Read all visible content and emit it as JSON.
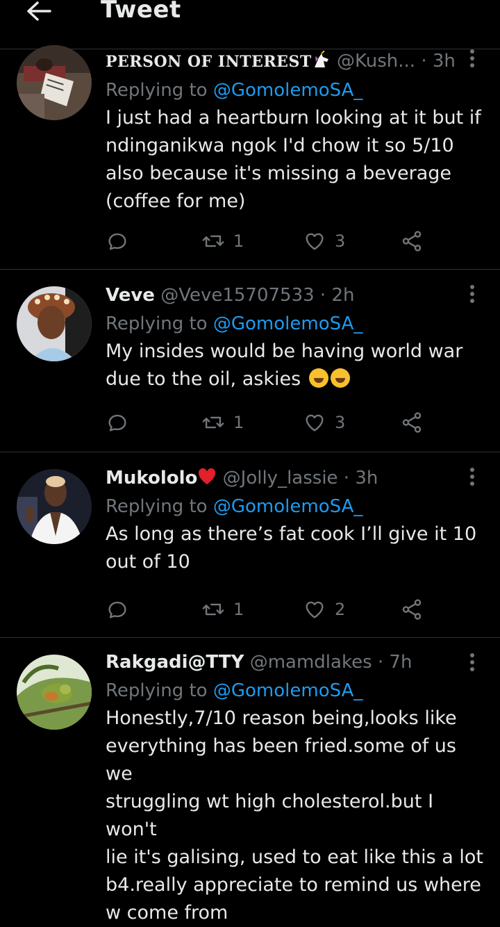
{
  "header": {
    "title": "Tweet",
    "back_icon": "arrow-left-icon"
  },
  "tweets": [
    {
      "name": "PERSON OF INTEREST",
      "name_emoji": "unicorn-icon",
      "handle": "@Kush...",
      "time": "3h",
      "replying_prefix": "Replying to",
      "replying_to": "@GomolemoSA_",
      "lines": [
        "I just had a heartburn looking at it but if",
        "ndinganikwa ngok I'd chow it so 5/10",
        "also because it's missing a beverage",
        "(coffee for me)"
      ],
      "retweets": "1",
      "likes": "3"
    },
    {
      "name": "Veve",
      "handle": "@Veve15707533",
      "time": "2h",
      "replying_prefix": "Replying to",
      "replying_to": "@GomolemoSA_",
      "lines": [
        "My insides would be having world war",
        "due to the oil, askies"
      ],
      "retweets": "1",
      "likes": "3"
    },
    {
      "name": "Mukololo",
      "handle": "@Jolly_lassie",
      "time": "3h",
      "replying_prefix": "Replying to",
      "replying_to": "@GomolemoSA_",
      "lines": [
        "As long as there’s fat cook I’ll give it 10",
        "out of 10"
      ],
      "retweets": "1",
      "likes": "2"
    },
    {
      "name": "Rakgadi@TTY",
      "handle": "@mamdlakes",
      "time": "7h",
      "replying_prefix": "Replying to",
      "replying_to": "@GomolemoSA_",
      "lines": [
        "Honestly,7/10 reason  being,looks like",
        "everything has been fried.some of us we",
        "struggling wt high cholesterol.but I won't",
        "lie it's galising, used to eat like this a  lot",
        "b4.really appreciate to remind us where",
        "w come from"
      ]
    }
  ],
  "colors": {
    "background": "#000000",
    "text": "#e7e9ea",
    "muted": "#71767b",
    "link": "#1d9bf0",
    "divider": "#2f3336"
  }
}
